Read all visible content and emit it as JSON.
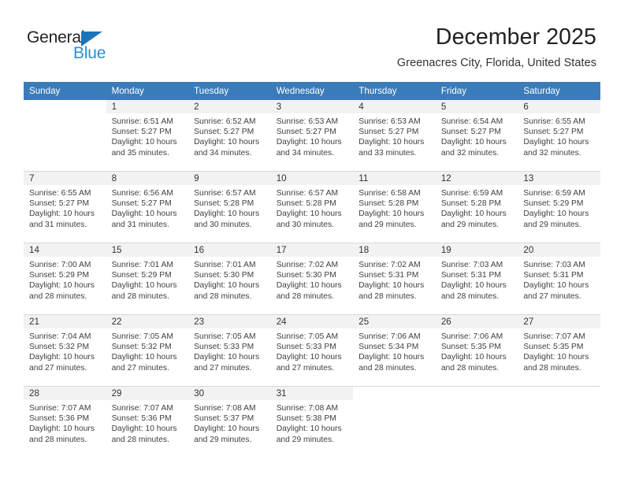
{
  "brand": {
    "name_part1": "General",
    "name_part2": "Blue",
    "triangle_icon": "triangle-icon",
    "color_dark": "#231f20",
    "color_blue": "#2a8fd4"
  },
  "header": {
    "title": "December 2025",
    "subtitle": "Greenacres City, Florida, United States",
    "header_bg": "#3a7cb9",
    "daynum_bg": "#f2f2f2"
  },
  "weekday_headers": [
    "Sunday",
    "Monday",
    "Tuesday",
    "Wednesday",
    "Thursday",
    "Friday",
    "Saturday"
  ],
  "weeks": [
    [
      {
        "day": "",
        "sunrise": "",
        "sunset": "",
        "daylight_line1": "",
        "daylight_line2": ""
      },
      {
        "day": "1",
        "sunrise": "Sunrise: 6:51 AM",
        "sunset": "Sunset: 5:27 PM",
        "daylight_line1": "Daylight: 10 hours",
        "daylight_line2": "and 35 minutes."
      },
      {
        "day": "2",
        "sunrise": "Sunrise: 6:52 AM",
        "sunset": "Sunset: 5:27 PM",
        "daylight_line1": "Daylight: 10 hours",
        "daylight_line2": "and 34 minutes."
      },
      {
        "day": "3",
        "sunrise": "Sunrise: 6:53 AM",
        "sunset": "Sunset: 5:27 PM",
        "daylight_line1": "Daylight: 10 hours",
        "daylight_line2": "and 34 minutes."
      },
      {
        "day": "4",
        "sunrise": "Sunrise: 6:53 AM",
        "sunset": "Sunset: 5:27 PM",
        "daylight_line1": "Daylight: 10 hours",
        "daylight_line2": "and 33 minutes."
      },
      {
        "day": "5",
        "sunrise": "Sunrise: 6:54 AM",
        "sunset": "Sunset: 5:27 PM",
        "daylight_line1": "Daylight: 10 hours",
        "daylight_line2": "and 32 minutes."
      },
      {
        "day": "6",
        "sunrise": "Sunrise: 6:55 AM",
        "sunset": "Sunset: 5:27 PM",
        "daylight_line1": "Daylight: 10 hours",
        "daylight_line2": "and 32 minutes."
      }
    ],
    [
      {
        "day": "7",
        "sunrise": "Sunrise: 6:55 AM",
        "sunset": "Sunset: 5:27 PM",
        "daylight_line1": "Daylight: 10 hours",
        "daylight_line2": "and 31 minutes."
      },
      {
        "day": "8",
        "sunrise": "Sunrise: 6:56 AM",
        "sunset": "Sunset: 5:27 PM",
        "daylight_line1": "Daylight: 10 hours",
        "daylight_line2": "and 31 minutes."
      },
      {
        "day": "9",
        "sunrise": "Sunrise: 6:57 AM",
        "sunset": "Sunset: 5:28 PM",
        "daylight_line1": "Daylight: 10 hours",
        "daylight_line2": "and 30 minutes."
      },
      {
        "day": "10",
        "sunrise": "Sunrise: 6:57 AM",
        "sunset": "Sunset: 5:28 PM",
        "daylight_line1": "Daylight: 10 hours",
        "daylight_line2": "and 30 minutes."
      },
      {
        "day": "11",
        "sunrise": "Sunrise: 6:58 AM",
        "sunset": "Sunset: 5:28 PM",
        "daylight_line1": "Daylight: 10 hours",
        "daylight_line2": "and 29 minutes."
      },
      {
        "day": "12",
        "sunrise": "Sunrise: 6:59 AM",
        "sunset": "Sunset: 5:28 PM",
        "daylight_line1": "Daylight: 10 hours",
        "daylight_line2": "and 29 minutes."
      },
      {
        "day": "13",
        "sunrise": "Sunrise: 6:59 AM",
        "sunset": "Sunset: 5:29 PM",
        "daylight_line1": "Daylight: 10 hours",
        "daylight_line2": "and 29 minutes."
      }
    ],
    [
      {
        "day": "14",
        "sunrise": "Sunrise: 7:00 AM",
        "sunset": "Sunset: 5:29 PM",
        "daylight_line1": "Daylight: 10 hours",
        "daylight_line2": "and 28 minutes."
      },
      {
        "day": "15",
        "sunrise": "Sunrise: 7:01 AM",
        "sunset": "Sunset: 5:29 PM",
        "daylight_line1": "Daylight: 10 hours",
        "daylight_line2": "and 28 minutes."
      },
      {
        "day": "16",
        "sunrise": "Sunrise: 7:01 AM",
        "sunset": "Sunset: 5:30 PM",
        "daylight_line1": "Daylight: 10 hours",
        "daylight_line2": "and 28 minutes."
      },
      {
        "day": "17",
        "sunrise": "Sunrise: 7:02 AM",
        "sunset": "Sunset: 5:30 PM",
        "daylight_line1": "Daylight: 10 hours",
        "daylight_line2": "and 28 minutes."
      },
      {
        "day": "18",
        "sunrise": "Sunrise: 7:02 AM",
        "sunset": "Sunset: 5:31 PM",
        "daylight_line1": "Daylight: 10 hours",
        "daylight_line2": "and 28 minutes."
      },
      {
        "day": "19",
        "sunrise": "Sunrise: 7:03 AM",
        "sunset": "Sunset: 5:31 PM",
        "daylight_line1": "Daylight: 10 hours",
        "daylight_line2": "and 28 minutes."
      },
      {
        "day": "20",
        "sunrise": "Sunrise: 7:03 AM",
        "sunset": "Sunset: 5:31 PM",
        "daylight_line1": "Daylight: 10 hours",
        "daylight_line2": "and 27 minutes."
      }
    ],
    [
      {
        "day": "21",
        "sunrise": "Sunrise: 7:04 AM",
        "sunset": "Sunset: 5:32 PM",
        "daylight_line1": "Daylight: 10 hours",
        "daylight_line2": "and 27 minutes."
      },
      {
        "day": "22",
        "sunrise": "Sunrise: 7:05 AM",
        "sunset": "Sunset: 5:32 PM",
        "daylight_line1": "Daylight: 10 hours",
        "daylight_line2": "and 27 minutes."
      },
      {
        "day": "23",
        "sunrise": "Sunrise: 7:05 AM",
        "sunset": "Sunset: 5:33 PM",
        "daylight_line1": "Daylight: 10 hours",
        "daylight_line2": "and 27 minutes."
      },
      {
        "day": "24",
        "sunrise": "Sunrise: 7:05 AM",
        "sunset": "Sunset: 5:33 PM",
        "daylight_line1": "Daylight: 10 hours",
        "daylight_line2": "and 27 minutes."
      },
      {
        "day": "25",
        "sunrise": "Sunrise: 7:06 AM",
        "sunset": "Sunset: 5:34 PM",
        "daylight_line1": "Daylight: 10 hours",
        "daylight_line2": "and 28 minutes."
      },
      {
        "day": "26",
        "sunrise": "Sunrise: 7:06 AM",
        "sunset": "Sunset: 5:35 PM",
        "daylight_line1": "Daylight: 10 hours",
        "daylight_line2": "and 28 minutes."
      },
      {
        "day": "27",
        "sunrise": "Sunrise: 7:07 AM",
        "sunset": "Sunset: 5:35 PM",
        "daylight_line1": "Daylight: 10 hours",
        "daylight_line2": "and 28 minutes."
      }
    ],
    [
      {
        "day": "28",
        "sunrise": "Sunrise: 7:07 AM",
        "sunset": "Sunset: 5:36 PM",
        "daylight_line1": "Daylight: 10 hours",
        "daylight_line2": "and 28 minutes."
      },
      {
        "day": "29",
        "sunrise": "Sunrise: 7:07 AM",
        "sunset": "Sunset: 5:36 PM",
        "daylight_line1": "Daylight: 10 hours",
        "daylight_line2": "and 28 minutes."
      },
      {
        "day": "30",
        "sunrise": "Sunrise: 7:08 AM",
        "sunset": "Sunset: 5:37 PM",
        "daylight_line1": "Daylight: 10 hours",
        "daylight_line2": "and 29 minutes."
      },
      {
        "day": "31",
        "sunrise": "Sunrise: 7:08 AM",
        "sunset": "Sunset: 5:38 PM",
        "daylight_line1": "Daylight: 10 hours",
        "daylight_line2": "and 29 minutes."
      },
      {
        "day": "",
        "sunrise": "",
        "sunset": "",
        "daylight_line1": "",
        "daylight_line2": ""
      },
      {
        "day": "",
        "sunrise": "",
        "sunset": "",
        "daylight_line1": "",
        "daylight_line2": ""
      },
      {
        "day": "",
        "sunrise": "",
        "sunset": "",
        "daylight_line1": "",
        "daylight_line2": ""
      }
    ]
  ]
}
